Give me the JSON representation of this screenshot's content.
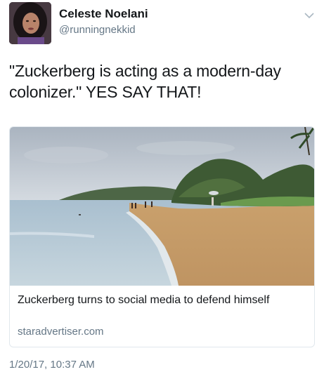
{
  "user": {
    "display_name": "Celeste Noelani",
    "handle": "@runningnekkid",
    "avatar_icon": "profile-photo"
  },
  "tweet": {
    "text": "\"Zuckerberg is acting as a modern-day colonizer.\" YES SAY THAT!",
    "timestamp": "1/20/17, 10:37 AM"
  },
  "card": {
    "title": "Zuckerberg turns to social media to defend himself",
    "domain": "staradvertiser.com",
    "image_icon": "beach-photo"
  },
  "menu": {
    "icon": "chevron-down-icon"
  },
  "colors": {
    "primary_text": "#14171a",
    "secondary_text": "#657786",
    "border": "#e1e8ed"
  }
}
